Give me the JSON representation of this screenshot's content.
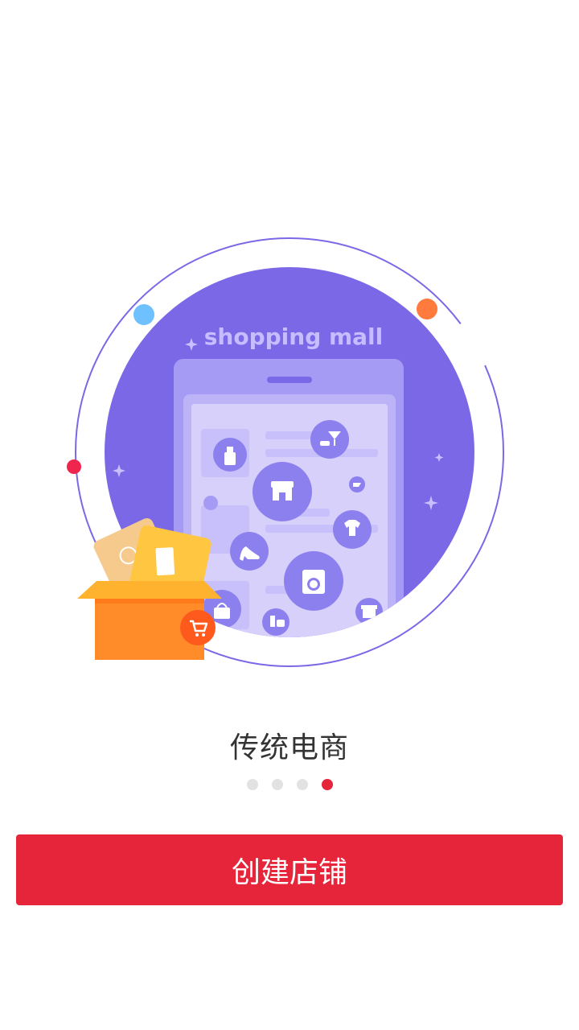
{
  "illustration": {
    "banner_text": "shopping mall",
    "icons": [
      "cleaning-spray-icon",
      "cocktail-icon",
      "storefront-icon",
      "shirt-icon",
      "high-heel-icon",
      "washing-machine-icon",
      "handbag-icon",
      "cosmetics-icon",
      "gift-icon",
      "shopping-cart-icon",
      "coupon-icon",
      "ticket-icon"
    ],
    "colors": {
      "circle": "#7b68e6",
      "phone": "#a59bf5",
      "screen": "#d6d0fb",
      "icon_bubble": "#8c80ef",
      "box": "#ff8c28",
      "cart_badge": "#ff5a1e"
    }
  },
  "onboarding": {
    "title": "传统电商",
    "page_count": 4,
    "active_page": 4
  },
  "cta": {
    "label": "创建店铺"
  },
  "colors": {
    "accent": "#e6253a",
    "dot_inactive": "#e2e2e2",
    "title_text": "#333333"
  }
}
